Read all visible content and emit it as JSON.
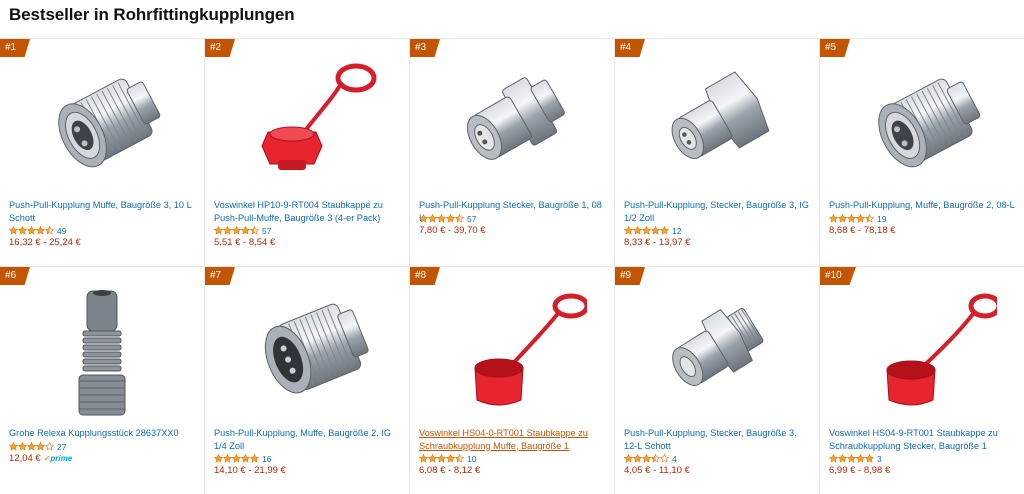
{
  "page": {
    "title": "Bestseller in Rohrfittingkupplungen"
  },
  "colors": {
    "accent": "#c45500",
    "link": "#0f6bb4",
    "price": "#b12704",
    "star": "#ffa41c"
  },
  "products": [
    {
      "rank": "#1",
      "title": "Push-Pull-Kupplung Muffe, Baugröße 3, 10 L Schott",
      "rating": 4.5,
      "reviews": "49",
      "price": "16,32 € - 25,24 €",
      "image": "coupling-sleeve-icon"
    },
    {
      "rank": "#2",
      "title": "Voswinkel HP10-9-RT004 Staubkappe zu Push-Pull-Muffe, Baugröße 3 (4-er Pack)",
      "rating": 4.5,
      "reviews": "57",
      "price": "5,51 € - 8,54 €",
      "image": "red-dust-plug-icon"
    },
    {
      "rank": "#3",
      "title": "Push-Pull-Kupplung Stecker, Baugröße 1, 08 L",
      "rating": 4.5,
      "reviews": "57",
      "price": "7,80 € - 39,70 €",
      "image": "coupling-plug-icon"
    },
    {
      "rank": "#4",
      "title": "Push-Pull-Kupplung, Stecker, Baugröße 3, IG 1/2 Zoll",
      "rating": 5,
      "reviews": "12",
      "price": "8,33 € - 13,97 €",
      "image": "coupling-plug-hex-icon"
    },
    {
      "rank": "#5",
      "title": "Push-Pull-Kupplung, Muffe, Baugröße 2, 08-L",
      "rating": 4.5,
      "reviews": "19",
      "price": "8,68 € - 78,18 €",
      "image": "coupling-sleeve-icon"
    },
    {
      "rank": "#6",
      "title": "Grohe Relexa Kupplungsstück 28637XX0",
      "rating": 4,
      "reviews": "27",
      "price": "12,04 €",
      "prime": "prime",
      "image": "grey-connector-icon"
    },
    {
      "rank": "#7",
      "title": "Push-Pull-Kupplung, Muffe, Baugröße 2, IG 1/4 Zoll",
      "rating": 5,
      "reviews": "16",
      "price": "14,10 € - 21,99 €",
      "image": "coupling-sleeve-side-icon"
    },
    {
      "rank": "#8",
      "title": "Voswinkel HS04-0-RT001 Staubkappe zu Schraubkupplung Muffe, Baugröße 1",
      "rating": 4.5,
      "reviews": "10",
      "price": "6,08 € - 8,12 €",
      "image": "red-dust-cap-icon"
    },
    {
      "rank": "#9",
      "title": "Push-Pull-Kupplung, Stecker, Baugröße 3, 12-L Schott",
      "rating": 3.5,
      "reviews": "4",
      "price": "4,05 € - 11,10 €",
      "image": "coupling-plug-bulkhead-icon"
    },
    {
      "rank": "#10",
      "title": "Voswinkel HS04-9-RT001 Staubkappe zu Schraubkupplung Stecker, Baugröße 1",
      "rating": 5,
      "reviews": "3",
      "price": "6,99 € - 8,98 €",
      "image": "red-dust-cap-icon"
    }
  ]
}
